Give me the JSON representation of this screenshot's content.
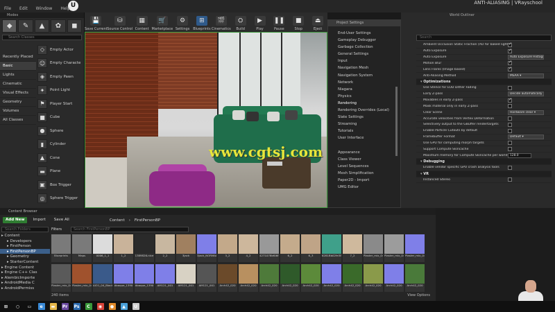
{
  "menu": [
    "File",
    "Edit",
    "Window",
    "Help"
  ],
  "header_title": "ANTI-ALIASING | VRayschool",
  "modes": {
    "tab": "Modes",
    "search_placeholder": "Search Classes",
    "categories": [
      "Recently Placed",
      "Basic",
      "Lights",
      "Cinematic",
      "Visual Effects",
      "Geometry",
      "Volumes",
      "All Classes"
    ],
    "actors": [
      "Empty Actor",
      "Empty Characte",
      "Empty Pawn",
      "Point Light",
      "Player Start",
      "Cube",
      "Sphere",
      "Cylinder",
      "Cone",
      "Plane",
      "Box Trigger",
      "Sphere Trigger"
    ]
  },
  "toolbar": [
    {
      "label": "Save Current",
      "icon": "save-icon",
      "glyph": "💾"
    },
    {
      "label": "Source Control",
      "icon": "source-control-icon",
      "glyph": "⛁"
    },
    {
      "label": "Content",
      "icon": "content-icon",
      "glyph": "▦"
    },
    {
      "label": "Marketplace",
      "icon": "marketplace-icon",
      "glyph": "🛒"
    },
    {
      "label": "Settings",
      "icon": "settings-icon",
      "glyph": "⚙"
    },
    {
      "label": "Blueprints",
      "icon": "blueprints-icon",
      "glyph": "⊞"
    },
    {
      "label": "Cinematics",
      "icon": "cinematics-icon",
      "glyph": "🎬"
    },
    {
      "label": "Build",
      "icon": "build-icon",
      "glyph": "⛭"
    },
    {
      "label": "Play",
      "icon": "play-icon",
      "glyph": "▶"
    },
    {
      "label": "Pause",
      "icon": "pause-icon",
      "glyph": "❚❚"
    },
    {
      "label": "Stop",
      "icon": "stop-icon",
      "glyph": "■"
    },
    {
      "label": "Eject",
      "icon": "eject-icon",
      "glyph": "⏏"
    }
  ],
  "viewport": {
    "watermark": "www.cgtsj.com"
  },
  "settings_menu": {
    "title": "Project Settings",
    "items": [
      "End-User Settings",
      "Gameplay Debugger",
      "Garbage Collection",
      "General Settings",
      "Input",
      "Navigation Mesh",
      "Navigation System",
      "Network",
      "Niagara",
      "Physics",
      "Rendering",
      "Rendering Overrides (Local)",
      "Slate Settings",
      "Streaming",
      "Tutorials",
      "User Interface",
      "",
      "Appearance",
      "Class Viewer",
      "Level Sequences",
      "Mesh Simplification",
      "Paper2D - Import",
      "UMG Editor"
    ],
    "selected": "Rendering"
  },
  "details": {
    "tab_title": "World Outliner",
    "search_placeholder": "Search",
    "rows": [
      {
        "kind": "prop",
        "name": "Ambient Occlusion Static Fraction (AO for baked lighting)",
        "control": "check",
        "on": true
      },
      {
        "kind": "prop",
        "name": "Auto Exposure",
        "control": "check",
        "on": true
      },
      {
        "kind": "prop",
        "name": "Auto Exposure",
        "control": "dropdown",
        "value": "Auto Exposure Histogram"
      },
      {
        "kind": "prop",
        "name": "Motion Blur",
        "control": "check",
        "on": true
      },
      {
        "kind": "prop",
        "name": "Lens Flares (Image based)",
        "control": "check",
        "on": true
      },
      {
        "kind": "prop",
        "name": "Anti-Aliasing Method",
        "control": "dropdown",
        "value": "MSAA"
      },
      {
        "kind": "section",
        "name": "Optimizations"
      },
      {
        "kind": "prop",
        "name": "Use Stencil for LOD Dither Fading",
        "control": "check",
        "on": false
      },
      {
        "kind": "prop",
        "name": "Early Z-pass",
        "control": "dropdown",
        "value": "Decide automatically"
      },
      {
        "kind": "prop",
        "name": "Movables in early Z-pass",
        "control": "check",
        "on": true
      },
      {
        "kind": "prop",
        "name": "Mask material only in early Z-pass",
        "control": "check",
        "on": false
      },
      {
        "kind": "prop",
        "name": "Clear Scene",
        "control": "dropdown",
        "value": "Hardware clear"
      },
      {
        "kind": "prop",
        "name": "Accurate velocities from Vertex Deformation",
        "control": "check",
        "on": false
      },
      {
        "kind": "prop",
        "name": "Selectively output to the GBuffer rendertargets",
        "control": "check",
        "on": false
      },
      {
        "kind": "prop",
        "name": "Enable Particle Cutouts by default",
        "control": "check",
        "on": false
      },
      {
        "kind": "prop",
        "name": "Framebuffer Format",
        "control": "dropdown",
        "value": "Default"
      },
      {
        "kind": "prop",
        "name": "Use GPU for computing morph targets",
        "control": "check",
        "on": false
      },
      {
        "kind": "prop",
        "name": "Support Compute Skincache",
        "control": "check",
        "on": false
      },
      {
        "kind": "prop",
        "name": "Maximum memory for Compute Skincache per world (MB)",
        "control": "number",
        "value": "128.0"
      },
      {
        "kind": "section",
        "name": "Debugging"
      },
      {
        "kind": "prop",
        "name": "Enable vendor specific GPU crash analysis tools",
        "control": "check",
        "on": false
      },
      {
        "kind": "section",
        "name": "VR"
      },
      {
        "kind": "prop",
        "name": "Instanced Stereo",
        "control": "check",
        "on": false
      }
    ]
  },
  "content_browser": {
    "title": "Content Browser",
    "add_new": "Add New",
    "import": "Import",
    "save_all": "Save All",
    "breadcrumb": [
      "Content",
      "FirstPersonBP"
    ],
    "folder_search": "Search Folders",
    "filters": "Filters",
    "asset_search": "Search FirstPersonBP",
    "folders": [
      "Content",
      "Developers",
      "FirstPerson",
      "FirstPersonBP",
      "Geometry",
      "StarterContent",
      "Engine Content",
      "Engine C++ Clas",
      "AlembicImporte",
      "AndroidMedia C",
      "AndroidPermiss"
    ],
    "selected_folder": "FirstPersonBP",
    "row1": [
      {
        "name": "Blueprints",
        "color": "#7a7a7a"
      },
      {
        "name": "Maps",
        "color": "#7a7a7a"
      },
      {
        "name": "0006_1_1",
        "color": "#dcdcdc"
      },
      {
        "name": "1_2",
        "color": "#c9b39a"
      },
      {
        "name": "1389826-nice",
        "color": "#2a2a2a"
      },
      {
        "name": "2_2",
        "color": "#c8b7a0"
      },
      {
        "name": "3jack",
        "color": "#a08060"
      },
      {
        "name": "3jack_NORMAL",
        "color": "#7f7fe8"
      },
      {
        "name": "3_2",
        "color": "#c3a98a"
      },
      {
        "name": "4_2",
        "color": "#cdb79c"
      },
      {
        "name": "4271078bf06f315fcec_c",
        "color": "#999999"
      },
      {
        "name": "6_2",
        "color": "#c4ab8c"
      },
      {
        "name": "6_3",
        "color": "#bfa487"
      },
      {
        "name": "6281Bb02fe380f4f0a_GREEN",
        "color": "#3fa08a"
      },
      {
        "name": "7_2",
        "color": "#cfb99d"
      },
      {
        "name": "Plaster_mix_04",
        "color": "#8a8a8a"
      },
      {
        "name": "Plaster_mix_04_rust",
        "color": "#9c9c9c"
      },
      {
        "name": "Plaster_mix_04_normal",
        "color": "#7f7fe8"
      }
    ],
    "row2": [
      {
        "name": "Plaster_mix_04_spec",
        "color": "#5a5a5a"
      },
      {
        "name": "Plaster_mix_04_thick",
        "color": "#a0522d"
      },
      {
        "name": "AIO1_04_Black",
        "color": "#3a5a8a"
      },
      {
        "name": "Abaque_1390",
        "color": "#7f7fe8"
      },
      {
        "name": "Abaque_1390",
        "color": "#7f7fe8"
      },
      {
        "name": "AM121_001",
        "color": "#7f7fe8"
      },
      {
        "name": "AM121_001",
        "color": "#d8d2c4"
      },
      {
        "name": "AM121_001",
        "color": "#555555"
      },
      {
        "name": "Arch42_020",
        "color": "#6b4a2a"
      },
      {
        "name": "Arch42_020",
        "color": "#b89060"
      },
      {
        "name": "Arch42_020",
        "color": "#4e7a3a"
      },
      {
        "name": "Arch42_020",
        "color": "#2f5a2a"
      },
      {
        "name": "Arch42_020",
        "color": "#5c8a3a"
      },
      {
        "name": "Arch42_020",
        "color": "#7f7fe8"
      },
      {
        "name": "Arch42_020",
        "color": "#3a6a2a"
      },
      {
        "name": "Arch42_020",
        "color": "#8a9a4a"
      },
      {
        "name": "Arch42_020",
        "color": "#7f7fe8"
      },
      {
        "name": "Arch42_020",
        "color": "#4a7a3a"
      }
    ],
    "item_count": "240 items",
    "view_options": "View Options"
  },
  "taskbar": [
    {
      "name": "windows-start-icon",
      "glyph": "⊞",
      "color": "#ffffff"
    },
    {
      "name": "search-icon",
      "glyph": "○",
      "color": "#ffffff"
    },
    {
      "name": "task-view-icon",
      "glyph": "▭",
      "color": "#ffffff"
    },
    {
      "name": "edge-icon",
      "glyph": "e",
      "color": "#3a8ad6"
    },
    {
      "name": "explorer-icon",
      "glyph": "▬",
      "color": "#e6b84a"
    },
    {
      "name": "premiere-icon",
      "glyph": "Pr",
      "color": "#6b4aa0"
    },
    {
      "name": "photoshop-icon",
      "glyph": "Ps",
      "color": "#2a6ab0"
    },
    {
      "name": "camtasia-icon",
      "glyph": "C",
      "color": "#3a9a3a"
    },
    {
      "name": "chrome-icon",
      "glyph": "◉",
      "color": "#d8443a"
    },
    {
      "name": "media-icon",
      "glyph": "●",
      "color": "#e08a2a"
    },
    {
      "name": "app-icon",
      "glyph": "▲",
      "color": "#4aa0d8"
    },
    {
      "name": "unreal-icon",
      "glyph": "U",
      "color": "#cccccc"
    }
  ],
  "colors": {
    "accent_green": "#2f7d32",
    "selection_blue": "#3b5f8a",
    "watermark": "#e7e63a"
  }
}
